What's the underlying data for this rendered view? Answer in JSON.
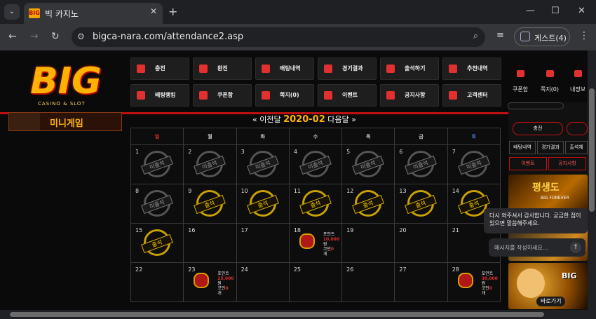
{
  "browser": {
    "tab_title": "빅 카지노",
    "favicon": "BIG",
    "url": "bigca-nara.com/attendance2.asp",
    "profile": "게스트(4)"
  },
  "logo": {
    "main": "BIG",
    "sub": "CASINO & SLOT"
  },
  "menu_row1": [
    "충전",
    "환전",
    "배팅내역",
    "경기결과",
    "출석하기",
    "추천내역"
  ],
  "menu_row2": [
    "배팅랭킹",
    "쿠폰함",
    "쪽지(0)",
    "이벤트",
    "공지사항",
    "고객센터"
  ],
  "util": [
    "쿠폰함",
    "쪽지(0)",
    "내정보"
  ],
  "mini_banner": "미니게임",
  "calendar": {
    "prev": "« 이전달",
    "month": "2020-02",
    "next": "다음달 »",
    "weekdays": [
      "일",
      "월",
      "화",
      "수",
      "목",
      "금",
      "토"
    ],
    "absent": "미출석",
    "present": "출석",
    "point_label": "포인트",
    "won": "원",
    "coin_label": "코인",
    "coin_count": "0",
    "coin_unit": "개",
    "days": [
      {
        "d": "1",
        "s": "absent"
      },
      {
        "d": "2",
        "s": "absent"
      },
      {
        "d": "3",
        "s": "absent"
      },
      {
        "d": "4",
        "s": "absent"
      },
      {
        "d": "5",
        "s": "absent"
      },
      {
        "d": "6",
        "s": "absent"
      },
      {
        "d": "7",
        "s": "absent"
      },
      {
        "d": "8",
        "s": "absent"
      },
      {
        "d": "9",
        "s": "present"
      },
      {
        "d": "10",
        "s": "present"
      },
      {
        "d": "11",
        "s": "present"
      },
      {
        "d": "12",
        "s": "present"
      },
      {
        "d": "13",
        "s": "present"
      },
      {
        "d": "14",
        "s": "present"
      },
      {
        "d": "15",
        "s": "present"
      },
      {
        "d": "16",
        "s": ""
      },
      {
        "d": "17",
        "s": ""
      },
      {
        "d": "18",
        "s": "gift",
        "amount": "10,000"
      },
      {
        "d": "19",
        "s": ""
      },
      {
        "d": "20",
        "s": ""
      },
      {
        "d": "21",
        "s": ""
      },
      {
        "d": "22",
        "s": ""
      },
      {
        "d": "23",
        "s": "gift",
        "amount": "25,000"
      },
      {
        "d": "24",
        "s": ""
      },
      {
        "d": "25",
        "s": ""
      },
      {
        "d": "26",
        "s": ""
      },
      {
        "d": "27",
        "s": ""
      },
      {
        "d": "28",
        "s": "gift",
        "amount": "30,000"
      }
    ]
  },
  "right": {
    "charge": "충전",
    "tabs": [
      "배팅내역",
      "경기결과",
      "출석체"
    ],
    "tabs2": [
      "이벤트",
      "공지사항"
    ],
    "banner1": "평생도",
    "banner1_sub": "BIG FOREVER",
    "banner2_btn": "바로가기"
  },
  "chat": {
    "message": "다시 와주셔서 감사합니다. 궁금한 점이 있으면 말씀해주세요.",
    "placeholder": "메시지를 작성하세요..."
  },
  "colors": {
    "accent": "#c01010",
    "gold": "#ffb300"
  }
}
